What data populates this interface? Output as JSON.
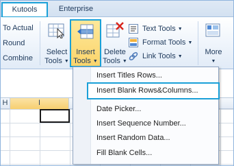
{
  "tabs": [
    {
      "label": "Kutools"
    },
    {
      "label": "Enterprise"
    }
  ],
  "ribbon": {
    "left_commands": [
      "To Actual",
      "Round",
      "Combine"
    ],
    "select_tools": {
      "line1": "Select",
      "line2": "Tools"
    },
    "insert_tools": {
      "line1": "Insert",
      "line2": "Tools"
    },
    "delete_tools": {
      "line1": "Delete",
      "line2": "Tools"
    },
    "small_commands": [
      "Text Tools",
      "Format Tools",
      "Link Tools"
    ],
    "more": {
      "label": "More"
    }
  },
  "sheet": {
    "columns": [
      "H",
      "I"
    ]
  },
  "menu": {
    "items": [
      "Insert Titles Rows...",
      "Insert Blank Rows&Columns...",
      "Date Picker...",
      "Insert Sequence Number...",
      "Insert Random Data...",
      "Fill Blank Cells..."
    ]
  },
  "colors": {
    "highlight": "#1aa0d8",
    "insert_button_fill": "#fbd46b",
    "ribbon_text": "#1e395b"
  }
}
